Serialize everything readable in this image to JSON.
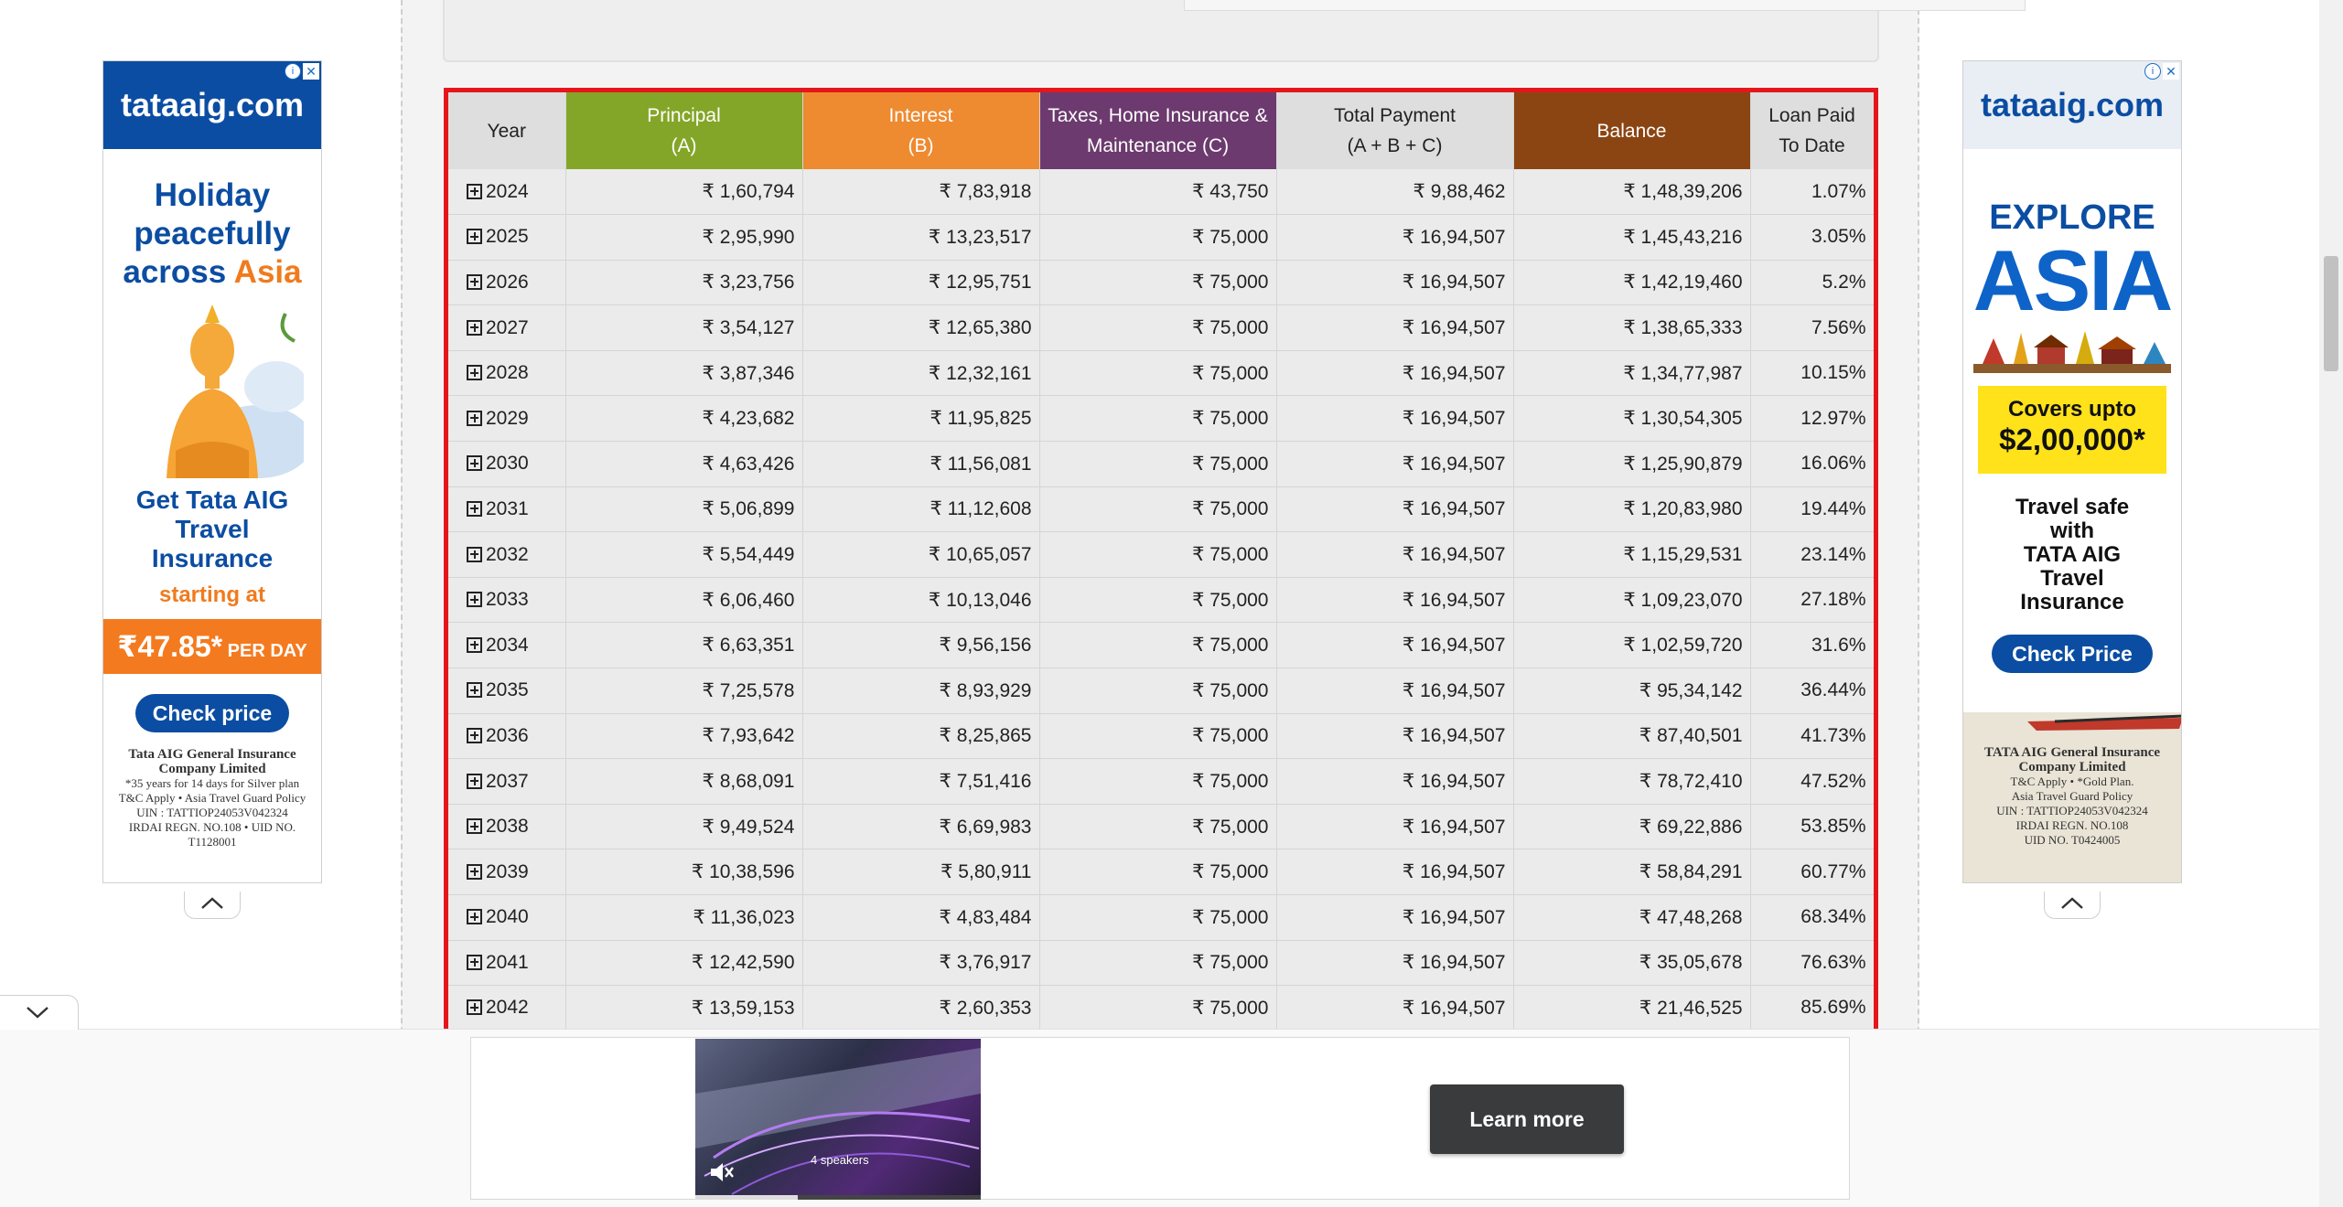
{
  "table": {
    "headers": {
      "year": "Year",
      "principal": "Principal\n(A)",
      "interest": "Interest\n(B)",
      "taxes": "Taxes, Home Insurance &\nMaintenance (C)",
      "total": "Total Payment\n(A + B + C)",
      "balance": "Balance",
      "paid": "Loan Paid\nTo Date"
    },
    "colors": {
      "principal_header": "#84a628",
      "interest_header": "#ee8a30",
      "taxes_header": "#6c3a6e",
      "balance_header": "#8b4513",
      "frame": "#e5161b"
    },
    "rows": [
      {
        "year": "2024",
        "principal": "₹ 1,60,794",
        "interest": "₹ 7,83,918",
        "taxes": "₹ 43,750",
        "total": "₹ 9,88,462",
        "balance": "₹ 1,48,39,206",
        "paid": "1.07%"
      },
      {
        "year": "2025",
        "principal": "₹ 2,95,990",
        "interest": "₹ 13,23,517",
        "taxes": "₹ 75,000",
        "total": "₹ 16,94,507",
        "balance": "₹ 1,45,43,216",
        "paid": "3.05%"
      },
      {
        "year": "2026",
        "principal": "₹ 3,23,756",
        "interest": "₹ 12,95,751",
        "taxes": "₹ 75,000",
        "total": "₹ 16,94,507",
        "balance": "₹ 1,42,19,460",
        "paid": "5.2%"
      },
      {
        "year": "2027",
        "principal": "₹ 3,54,127",
        "interest": "₹ 12,65,380",
        "taxes": "₹ 75,000",
        "total": "₹ 16,94,507",
        "balance": "₹ 1,38,65,333",
        "paid": "7.56%"
      },
      {
        "year": "2028",
        "principal": "₹ 3,87,346",
        "interest": "₹ 12,32,161",
        "taxes": "₹ 75,000",
        "total": "₹ 16,94,507",
        "balance": "₹ 1,34,77,987",
        "paid": "10.15%"
      },
      {
        "year": "2029",
        "principal": "₹ 4,23,682",
        "interest": "₹ 11,95,825",
        "taxes": "₹ 75,000",
        "total": "₹ 16,94,507",
        "balance": "₹ 1,30,54,305",
        "paid": "12.97%"
      },
      {
        "year": "2030",
        "principal": "₹ 4,63,426",
        "interest": "₹ 11,56,081",
        "taxes": "₹ 75,000",
        "total": "₹ 16,94,507",
        "balance": "₹ 1,25,90,879",
        "paid": "16.06%"
      },
      {
        "year": "2031",
        "principal": "₹ 5,06,899",
        "interest": "₹ 11,12,608",
        "taxes": "₹ 75,000",
        "total": "₹ 16,94,507",
        "balance": "₹ 1,20,83,980",
        "paid": "19.44%"
      },
      {
        "year": "2032",
        "principal": "₹ 5,54,449",
        "interest": "₹ 10,65,057",
        "taxes": "₹ 75,000",
        "total": "₹ 16,94,507",
        "balance": "₹ 1,15,29,531",
        "paid": "23.14%"
      },
      {
        "year": "2033",
        "principal": "₹ 6,06,460",
        "interest": "₹ 10,13,046",
        "taxes": "₹ 75,000",
        "total": "₹ 16,94,507",
        "balance": "₹ 1,09,23,070",
        "paid": "27.18%"
      },
      {
        "year": "2034",
        "principal": "₹ 6,63,351",
        "interest": "₹ 9,56,156",
        "taxes": "₹ 75,000",
        "total": "₹ 16,94,507",
        "balance": "₹ 1,02,59,720",
        "paid": "31.6%"
      },
      {
        "year": "2035",
        "principal": "₹ 7,25,578",
        "interest": "₹ 8,93,929",
        "taxes": "₹ 75,000",
        "total": "₹ 16,94,507",
        "balance": "₹ 95,34,142",
        "paid": "36.44%"
      },
      {
        "year": "2036",
        "principal": "₹ 7,93,642",
        "interest": "₹ 8,25,865",
        "taxes": "₹ 75,000",
        "total": "₹ 16,94,507",
        "balance": "₹ 87,40,501",
        "paid": "41.73%"
      },
      {
        "year": "2037",
        "principal": "₹ 8,68,091",
        "interest": "₹ 7,51,416",
        "taxes": "₹ 75,000",
        "total": "₹ 16,94,507",
        "balance": "₹ 78,72,410",
        "paid": "47.52%"
      },
      {
        "year": "2038",
        "principal": "₹ 9,49,524",
        "interest": "₹ 6,69,983",
        "taxes": "₹ 75,000",
        "total": "₹ 16,94,507",
        "balance": "₹ 69,22,886",
        "paid": "53.85%"
      },
      {
        "year": "2039",
        "principal": "₹ 10,38,596",
        "interest": "₹ 5,80,911",
        "taxes": "₹ 75,000",
        "total": "₹ 16,94,507",
        "balance": "₹ 58,84,291",
        "paid": "60.77%"
      },
      {
        "year": "2040",
        "principal": "₹ 11,36,023",
        "interest": "₹ 4,83,484",
        "taxes": "₹ 75,000",
        "total": "₹ 16,94,507",
        "balance": "₹ 47,48,268",
        "paid": "68.34%"
      },
      {
        "year": "2041",
        "principal": "₹ 12,42,590",
        "interest": "₹ 3,76,917",
        "taxes": "₹ 75,000",
        "total": "₹ 16,94,507",
        "balance": "₹ 35,05,678",
        "paid": "76.63%"
      },
      {
        "year": "2042",
        "principal": "₹ 13,59,153",
        "interest": "₹ 2,60,353",
        "taxes": "₹ 75,000",
        "total": "₹ 16,94,507",
        "balance": "₹ 21,46,525",
        "paid": "85.69%"
      }
    ]
  },
  "ad_left": {
    "brand": "tataaig.com",
    "headline_1": "Holiday",
    "headline_2": "peacefully",
    "headline_3a": "across ",
    "headline_3b": "Asia",
    "product_1": "Get Tata AIG",
    "product_2": "Travel",
    "product_3": "Insurance",
    "starting_at": "starting at",
    "price": "₹47.85*",
    "price_unit": " PER DAY",
    "cta": "Check price",
    "fine_company": "Tata AIG General Insurance Company Limited",
    "fine_1": "*35 years for 14 days for Silver plan",
    "fine_2": "T&C Apply • Asia Travel Guard Policy",
    "fine_3": "UIN : TATTIOP24053V042324",
    "fine_4": "IRDAI REGN. NO.108 • UID NO. T1128001",
    "info_icon": "i",
    "close_icon": "✕"
  },
  "ad_right": {
    "brand": "tataaig.com",
    "explore": "EXPLORE",
    "asia": "ASIA",
    "covers_1": "Covers upto",
    "covers_2": "$2,00,000*",
    "travel_1": "Travel safe",
    "travel_2": "with",
    "travel_3": "TATA AIG",
    "travel_4": "Travel",
    "travel_5": "Insurance",
    "cta": "Check Price",
    "fine_company": "TATA AIG General Insurance Company Limited",
    "fine_1": "T&C Apply • *Gold Plan.",
    "fine_2": "Asia Travel Guard Policy",
    "fine_3": "UIN : TATTIOP24053V042324",
    "fine_4": "IRDAI REGN. NO.108",
    "fine_5": "UID NO. T0424005",
    "info_icon": "i",
    "close_icon": "✕"
  },
  "bottom_ad": {
    "speakers_label": "4 speakers",
    "video_progress": 0.36,
    "learn_more": "Learn more"
  }
}
